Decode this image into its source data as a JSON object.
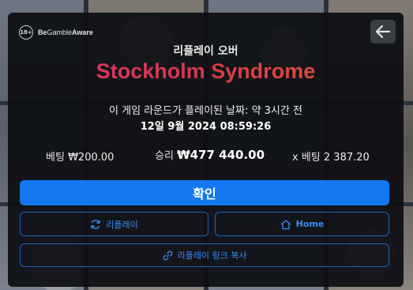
{
  "brand": {
    "age_badge": "18+",
    "name_bold_1": "Be",
    "name_regular": "Gamble",
    "name_bold_2": "Aware"
  },
  "header": {
    "title": "리플레이 오버"
  },
  "game": {
    "name": "Stockholm Syndrome"
  },
  "round": {
    "played_label": "이 게임 라운드가 플레이된 날짜: 약 3시간 전",
    "datetime": "12일 9월 2024 08:59:26"
  },
  "stats": {
    "bet_label": "베팅",
    "bet_value": "₩200.00",
    "win_label": "승리",
    "win_value": "₩477 440.00",
    "multiplier_label": "x 베팅",
    "multiplier_value": "2 387.20"
  },
  "buttons": {
    "confirm": "확인",
    "replay": "리플레이",
    "home": "Home",
    "copy_link": "리플레이 링크 복사"
  },
  "icons": {
    "back": "arrow-left-icon",
    "replay": "refresh-icon",
    "home": "home-icon",
    "copy_link": "link-icon"
  },
  "colors": {
    "accent": "#1478f0",
    "outline": "#1f63c4",
    "title_gradient_start": "#e0336f",
    "title_gradient_end": "#e05a2f"
  }
}
